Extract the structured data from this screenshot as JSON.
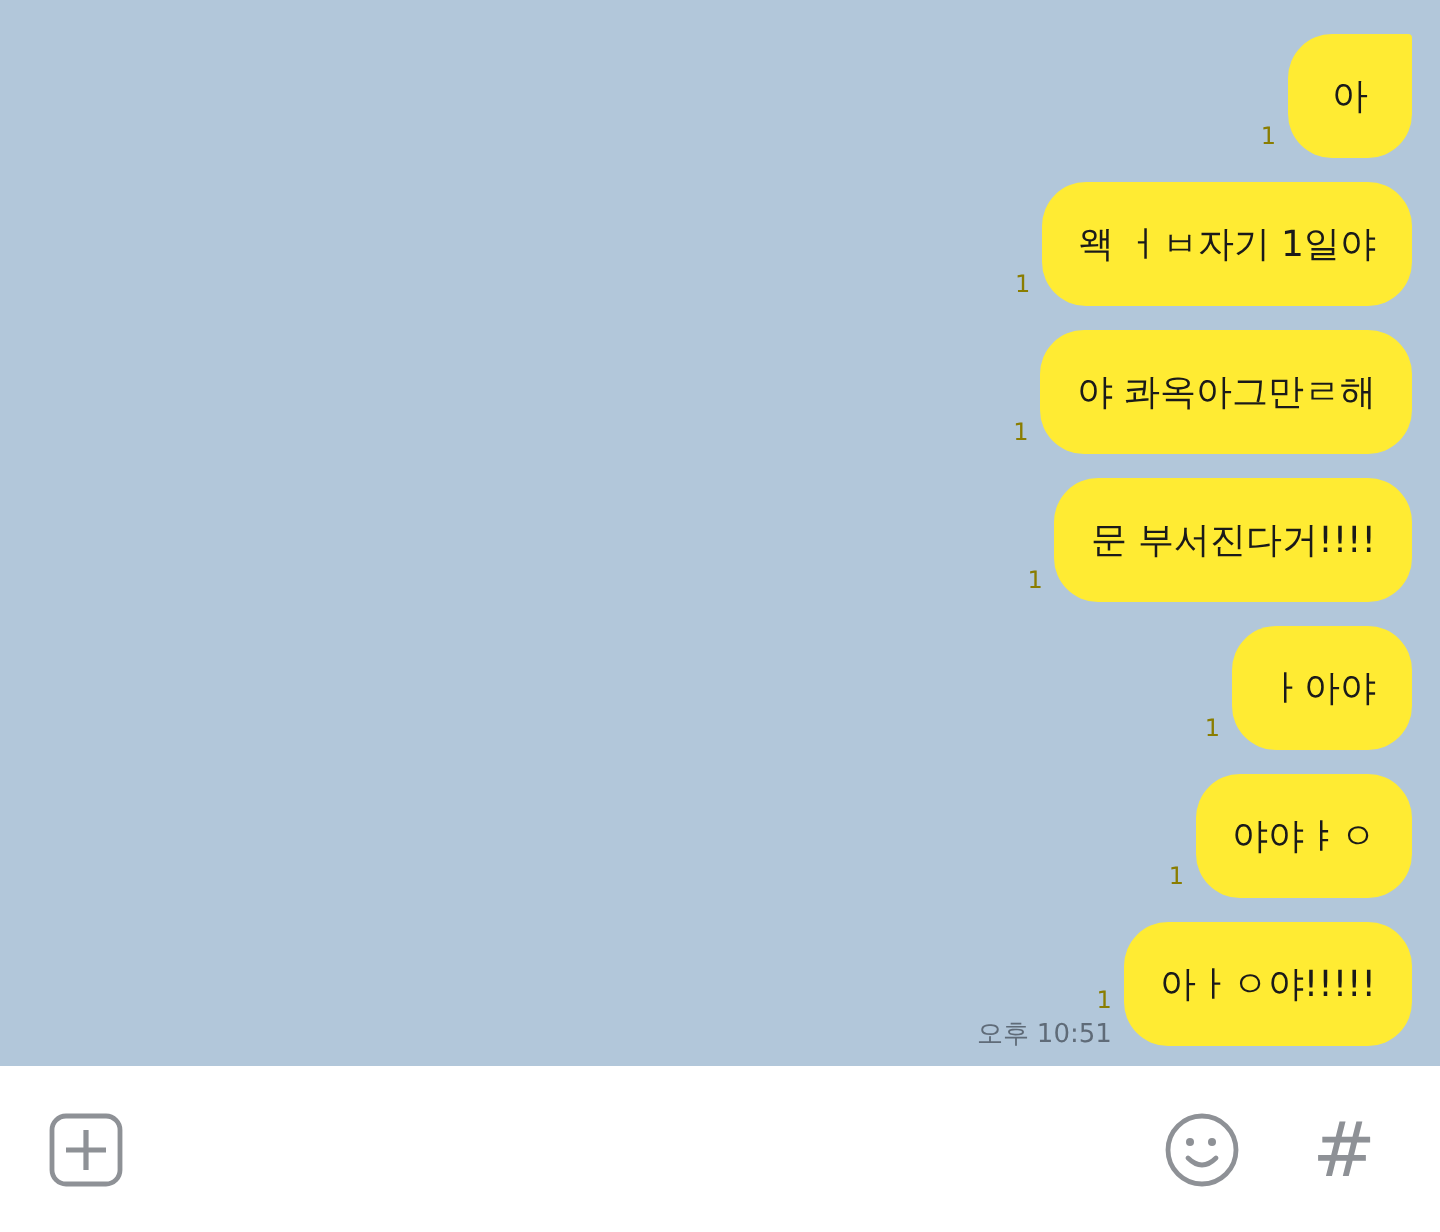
{
  "messages": [
    {
      "text": "아",
      "unread": "1",
      "tail": true
    },
    {
      "text": "왝 ㅓㅂ자기 1일야",
      "unread": "1",
      "tail": false
    },
    {
      "text": "야 콰옥아그만ㄹ해",
      "unread": "1",
      "tail": false
    },
    {
      "text": "문 부서진다거!!!!",
      "unread": "1",
      "tail": false
    },
    {
      "text": "ㅏ아야",
      "unread": "1",
      "tail": false
    },
    {
      "text": "야야ㅑㅇ",
      "unread": "1",
      "tail": false
    },
    {
      "text": "아ㅏㅇ야!!!!!",
      "unread": "1",
      "tail": false,
      "time": "오후 10:51"
    }
  ],
  "input_bar": {
    "hashtag": "#"
  }
}
